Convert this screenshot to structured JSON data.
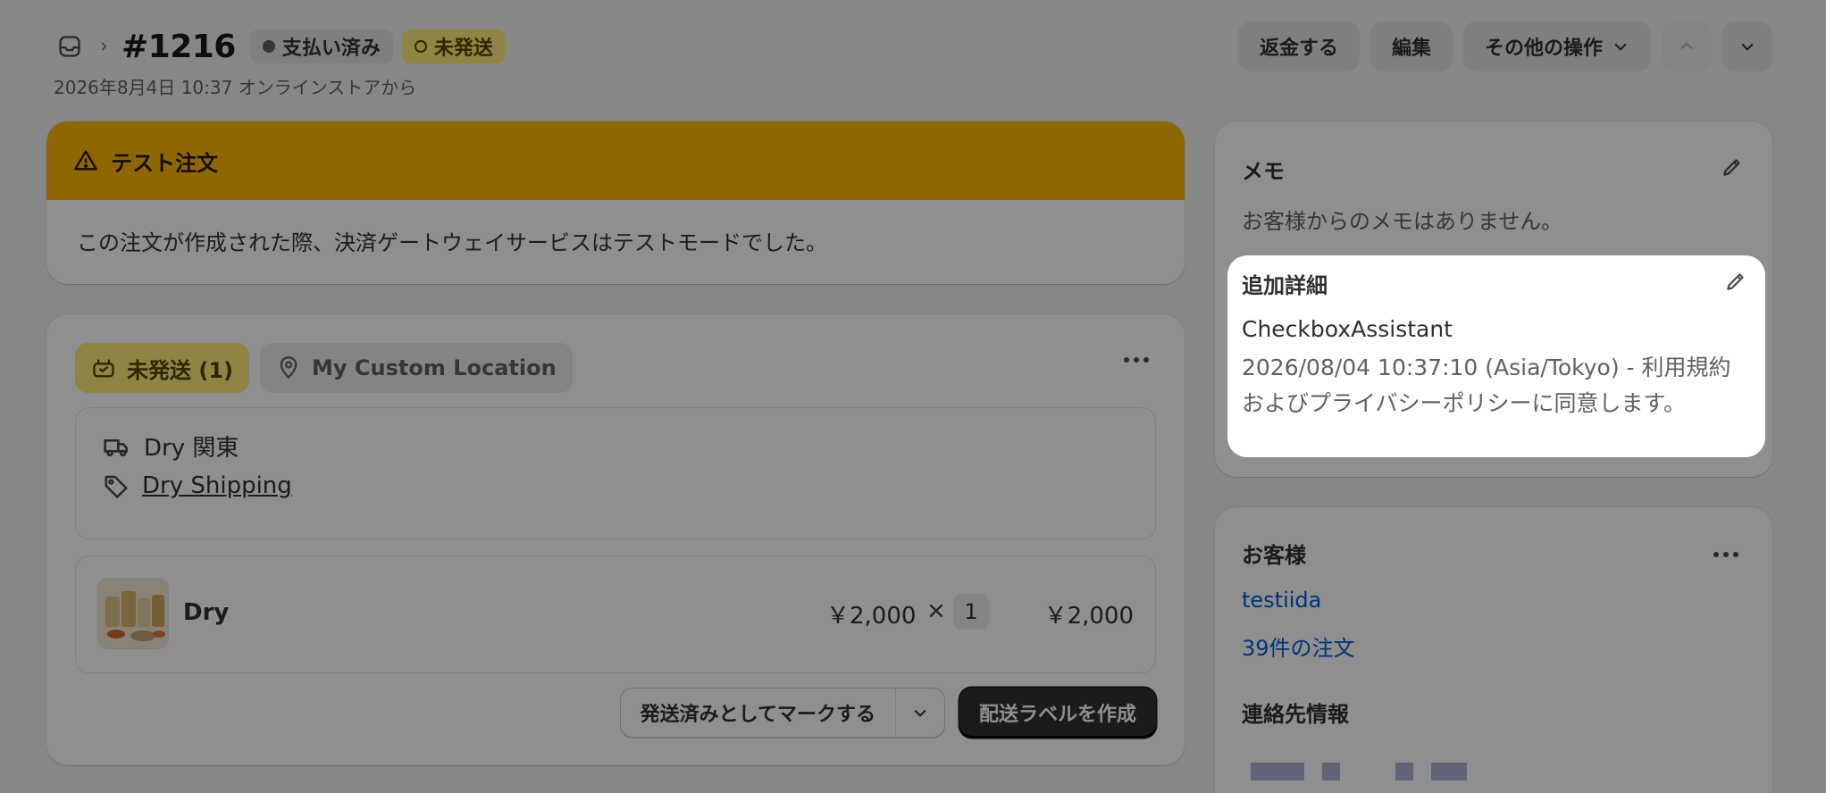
{
  "header": {
    "order_number": "#1216",
    "badge_paid": "支払い済み",
    "badge_unfulfilled": "未発送",
    "subtitle": "2026年8月4日 10:37 オンラインストアから",
    "buttons": {
      "refund": "返金する",
      "edit": "編集",
      "more_actions": "その他の操作"
    }
  },
  "test_banner": {
    "title": "テスト注文",
    "body": "この注文が作成された際、決済ゲートウェイサービスはテストモードでした。"
  },
  "fulfillment": {
    "status_label": "未発送 (1)",
    "location": "My Custom Location",
    "shipping_method": "Dry 関東",
    "shipping_profile": "Dry Shipping",
    "item": {
      "name": "Dry",
      "unit_price": "￥2,000",
      "times": "×",
      "quantity": "1",
      "total": "￥2,000"
    },
    "mark_fulfilled": "発送済みとしてマークする",
    "create_label": "配送ラベルを作成"
  },
  "memo": {
    "title": "メモ",
    "empty": "お客様からのメモはありません。"
  },
  "additional_details": {
    "title": "追加詳細",
    "name": "CheckboxAssistant",
    "text": "2026/08/04 10:37:10 (Asia/Tokyo) - 利用規約およびプライバシーポリシーに同意します。"
  },
  "customer": {
    "title": "お客様",
    "name": "testiida",
    "orders": "39件の注文",
    "contact_title": "連絡先情報"
  },
  "colors": {
    "banner": "#ffb800",
    "badge_yellow": "#ffeb78",
    "link": "#005bd3",
    "primary_button": "#303030"
  }
}
